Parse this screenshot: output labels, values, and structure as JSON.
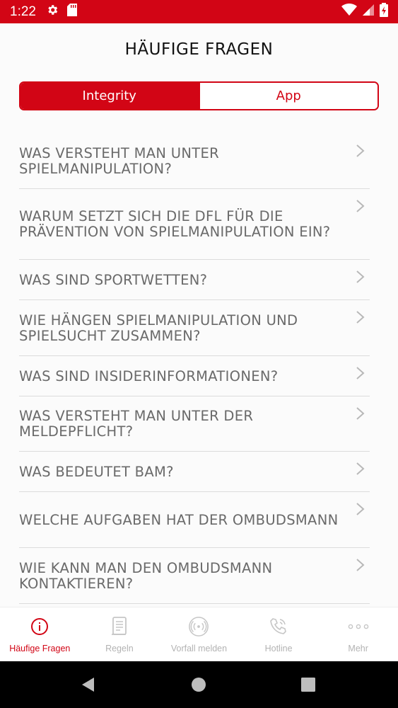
{
  "status_bar": {
    "time": "1:22",
    "bg_color": "#d20515"
  },
  "header": {
    "title": "HÄUFIGE FRAGEN"
  },
  "segments": {
    "active_label": "Integrity",
    "inactive_label": "App"
  },
  "faq": [
    {
      "question": "WAS VERSTEHT MAN UNTER SPIELMANIPULATION?"
    },
    {
      "question": "WARUM SETZT SICH DIE DFL FÜR DIE PRÄVENTION VON SPIELMANIPULATION EIN?"
    },
    {
      "question": "WAS SIND SPORTWETTEN?"
    },
    {
      "question": "WIE HÄNGEN SPIELMANIPULATION UND SPIELSUCHT ZUSAMMEN?"
    },
    {
      "question": "WAS SIND INSIDERINFORMATIONEN?"
    },
    {
      "question": "WAS VERSTEHT MAN UNTER DER MELDEPFLICHT?"
    },
    {
      "question": "WAS BEDEUTET BAM?"
    },
    {
      "question": "WELCHE AUFGABEN HAT DER OMBUDSMANN"
    },
    {
      "question": "WIE KANN MAN DEN OMBUDSMANN KONTAKTIEREN?"
    }
  ],
  "bottom_nav": {
    "items": [
      {
        "label": "Häufige Fragen",
        "icon": "info-icon",
        "active": true
      },
      {
        "label": "Regeln",
        "icon": "scroll-icon",
        "active": false
      },
      {
        "label": "Vorfall melden",
        "icon": "broadcast-icon",
        "active": false
      },
      {
        "label": "Hotline",
        "icon": "phone-icon",
        "active": false
      },
      {
        "label": "Mehr",
        "icon": "more-icon",
        "active": false
      }
    ]
  },
  "accent_color": "#d20515",
  "inactive_color": "#b3b3b3"
}
